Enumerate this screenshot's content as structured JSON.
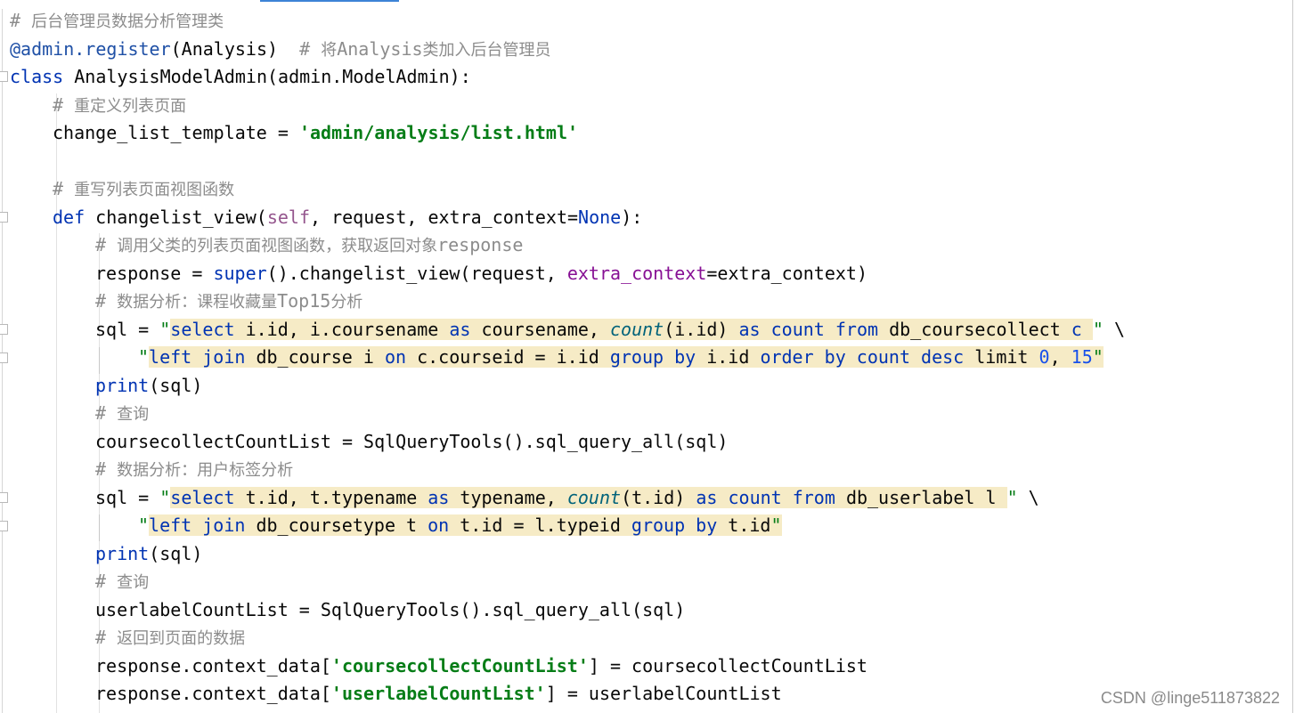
{
  "editor": {
    "lines": [
      {
        "indent": 0,
        "segs": [
          {
            "c": "cm",
            "t": "# "
          },
          {
            "c": "cm cn",
            "t": "后台管理员数据分析管理类"
          }
        ]
      },
      {
        "indent": 0,
        "segs": [
          {
            "c": "dec",
            "t": "@admin.register"
          },
          {
            "c": "",
            "t": "(Analysis)  "
          },
          {
            "c": "cm",
            "t": "# "
          },
          {
            "c": "cm cn",
            "t": "将"
          },
          {
            "c": "cm",
            "t": "Analysis"
          },
          {
            "c": "cm cn",
            "t": "类加入后台管理员"
          }
        ]
      },
      {
        "indent": 0,
        "segs": [
          {
            "c": "kw",
            "t": "class "
          },
          {
            "c": "",
            "t": "AnalysisModelAdmin(admin.ModelAdmin):"
          }
        ]
      },
      {
        "indent": 1,
        "segs": [
          {
            "c": "cm",
            "t": "# "
          },
          {
            "c": "cm cn",
            "t": "重定义列表页面"
          }
        ]
      },
      {
        "indent": 1,
        "segs": [
          {
            "c": "",
            "t": "change_list_template = "
          },
          {
            "c": "st-b",
            "t": "'admin/analysis/list.html'"
          }
        ]
      },
      {
        "indent": 0,
        "segs": []
      },
      {
        "indent": 1,
        "segs": [
          {
            "c": "cm",
            "t": "# "
          },
          {
            "c": "cm cn",
            "t": "重写列表页面视图函数"
          }
        ]
      },
      {
        "indent": 1,
        "segs": [
          {
            "c": "kw",
            "t": "def "
          },
          {
            "c": "",
            "t": "changelist_view("
          },
          {
            "c": "selfc",
            "t": "self"
          },
          {
            "c": "",
            "t": ", request, extra_context="
          },
          {
            "c": "kw",
            "t": "None"
          },
          {
            "c": "",
            "t": "):"
          }
        ]
      },
      {
        "indent": 2,
        "segs": [
          {
            "c": "cm",
            "t": "# "
          },
          {
            "c": "cm cn",
            "t": "调用父类的列表页面视图函数，获取返回对象"
          },
          {
            "c": "cm",
            "t": "response"
          }
        ]
      },
      {
        "indent": 2,
        "segs": [
          {
            "c": "",
            "t": "response = "
          },
          {
            "c": "bi",
            "t": "super"
          },
          {
            "c": "",
            "t": "().changelist_view(request, "
          },
          {
            "c": "par",
            "t": "extra_context"
          },
          {
            "c": "",
            "t": "=extra_context)"
          }
        ]
      },
      {
        "indent": 2,
        "segs": [
          {
            "c": "cm",
            "t": "# "
          },
          {
            "c": "cm cn",
            "t": "数据分析：课程收藏量"
          },
          {
            "c": "cm",
            "t": "Top15"
          },
          {
            "c": "cm cn",
            "t": "分析"
          }
        ]
      },
      {
        "indent": 2,
        "segs": [
          {
            "c": "",
            "t": "sql = "
          },
          {
            "c": "st",
            "t": "\""
          },
          {
            "c": "hl sqlkw",
            "t": "select "
          },
          {
            "c": "hl",
            "t": "i.id, i.coursename "
          },
          {
            "c": "hl sqlkw",
            "t": "as "
          },
          {
            "c": "hl",
            "t": "coursename, "
          },
          {
            "c": "hl sqlfn",
            "t": "count"
          },
          {
            "c": "hl",
            "t": "(i.id) "
          },
          {
            "c": "hl sqlkw",
            "t": "as count from "
          },
          {
            "c": "hl",
            "t": "db_coursecollect "
          },
          {
            "c": "hl sqlkw",
            "t": "c "
          },
          {
            "c": "st",
            "t": "\""
          },
          {
            "c": "",
            "t": " \\"
          }
        ]
      },
      {
        "indent": 3,
        "segs": [
          {
            "c": "st",
            "t": "\""
          },
          {
            "c": "hl sqlkw",
            "t": "left join "
          },
          {
            "c": "hl",
            "t": "db_course i "
          },
          {
            "c": "hl sqlkw",
            "t": "on "
          },
          {
            "c": "hl",
            "t": "c.courseid = i.id "
          },
          {
            "c": "hl sqlkw",
            "t": "group by "
          },
          {
            "c": "hl",
            "t": "i.id "
          },
          {
            "c": "hl sqlkw",
            "t": "order by count desc "
          },
          {
            "c": "hl",
            "t": "limit "
          },
          {
            "c": "hl num",
            "t": "0"
          },
          {
            "c": "hl",
            "t": ", "
          },
          {
            "c": "hl num",
            "t": "15"
          },
          {
            "c": "st hl",
            "t": "\""
          }
        ]
      },
      {
        "indent": 2,
        "segs": [
          {
            "c": "bi",
            "t": "print"
          },
          {
            "c": "",
            "t": "(sql)"
          }
        ]
      },
      {
        "indent": 2,
        "segs": [
          {
            "c": "cm",
            "t": "# "
          },
          {
            "c": "cm cn",
            "t": "查询"
          }
        ]
      },
      {
        "indent": 2,
        "segs": [
          {
            "c": "",
            "t": "coursecollectCountList = SqlQueryTools().sql_query_all(sql)"
          }
        ]
      },
      {
        "indent": 2,
        "segs": [
          {
            "c": "cm",
            "t": "# "
          },
          {
            "c": "cm cn",
            "t": "数据分析：用户标签分析"
          }
        ]
      },
      {
        "indent": 2,
        "segs": [
          {
            "c": "",
            "t": "sql = "
          },
          {
            "c": "st",
            "t": "\""
          },
          {
            "c": "hl sqlkw",
            "t": "select "
          },
          {
            "c": "hl",
            "t": "t.id, t.typename "
          },
          {
            "c": "hl sqlkw",
            "t": "as "
          },
          {
            "c": "hl",
            "t": "typename, "
          },
          {
            "c": "hl sqlfn",
            "t": "count"
          },
          {
            "c": "hl",
            "t": "(t.id) "
          },
          {
            "c": "hl sqlkw",
            "t": "as count from "
          },
          {
            "c": "hl",
            "t": "db_userlabel l "
          },
          {
            "c": "st",
            "t": "\""
          },
          {
            "c": "",
            "t": " \\"
          }
        ]
      },
      {
        "indent": 3,
        "segs": [
          {
            "c": "st",
            "t": "\""
          },
          {
            "c": "hl sqlkw",
            "t": "left join "
          },
          {
            "c": "hl",
            "t": "db_coursetype t "
          },
          {
            "c": "hl sqlkw",
            "t": "on "
          },
          {
            "c": "hl",
            "t": "t.id = l.typeid "
          },
          {
            "c": "hl sqlkw",
            "t": "group by "
          },
          {
            "c": "hl",
            "t": "t.id"
          },
          {
            "c": "st hl",
            "t": "\""
          }
        ]
      },
      {
        "indent": 2,
        "segs": [
          {
            "c": "bi",
            "t": "print"
          },
          {
            "c": "",
            "t": "(sql)"
          }
        ]
      },
      {
        "indent": 2,
        "segs": [
          {
            "c": "cm",
            "t": "# "
          },
          {
            "c": "cm cn",
            "t": "查询"
          }
        ]
      },
      {
        "indent": 2,
        "segs": [
          {
            "c": "",
            "t": "userlabelCountList = SqlQueryTools().sql_query_all(sql)"
          }
        ]
      },
      {
        "indent": 2,
        "segs": [
          {
            "c": "cm",
            "t": "# "
          },
          {
            "c": "cm cn",
            "t": "返回到页面的数据"
          }
        ]
      },
      {
        "indent": 2,
        "segs": [
          {
            "c": "",
            "t": "response.context_data["
          },
          {
            "c": "st-b",
            "t": "'coursecollectCountList'"
          },
          {
            "c": "",
            "t": "] = coursecollectCountList"
          }
        ]
      },
      {
        "indent": 2,
        "segs": [
          {
            "c": "",
            "t": "response.context_data["
          },
          {
            "c": "st-b",
            "t": "'userlabelCountList'"
          },
          {
            "c": "",
            "t": "] = userlabelCountList"
          }
        ]
      }
    ]
  },
  "watermark": "CSDN @linge511873822"
}
